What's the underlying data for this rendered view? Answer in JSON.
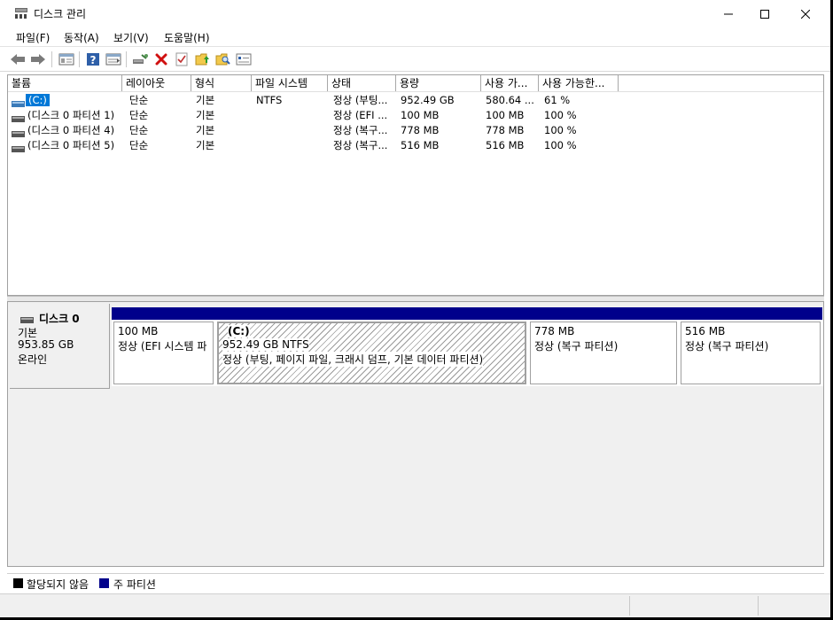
{
  "window": {
    "title": "디스크 관리",
    "icon": "disk-management-icon"
  },
  "menu": [
    {
      "label": "파일(F)"
    },
    {
      "label": "동작(A)"
    },
    {
      "label": "보기(V)"
    },
    {
      "label": "도움말(H)"
    }
  ],
  "toolbar": {
    "buttons": [
      "back-icon",
      "forward-icon",
      "show-hide-tree-icon",
      "help-icon",
      "properties-view-icon",
      "connect-drive-icon",
      "delete-icon",
      "check-icon",
      "folder-up-icon",
      "folder-search-icon",
      "settings-list-icon"
    ]
  },
  "columns": [
    "볼륨",
    "레이아웃",
    "형식",
    "파일 시스템",
    "상태",
    "용량",
    "사용 가...",
    "사용 가능한..."
  ],
  "volumes": [
    {
      "name": "(C:)",
      "layout": "단순",
      "type": "기본",
      "fs": "NTFS",
      "status": "정상 (부팅...",
      "capacity": "952.49 GB",
      "free": "580.64 ...",
      "free_pct": "61 %"
    },
    {
      "name": "(디스크 0 파티션 1)",
      "layout": "단순",
      "type": "기본",
      "fs": "",
      "status": "정상 (EFI ...",
      "capacity": "100 MB",
      "free": "100 MB",
      "free_pct": "100 %"
    },
    {
      "name": "(디스크 0 파티션 4)",
      "layout": "단순",
      "type": "기본",
      "fs": "",
      "status": "정상 (복구...",
      "capacity": "778 MB",
      "free": "778 MB",
      "free_pct": "100 %"
    },
    {
      "name": "(디스크 0 파티션 5)",
      "layout": "단순",
      "type": "기본",
      "fs": "",
      "status": "정상 (복구...",
      "capacity": "516 MB",
      "free": "516 MB",
      "free_pct": "100 %"
    }
  ],
  "disk": {
    "name": "디스크 0",
    "type": "기본",
    "size": "953.85 GB",
    "state": "온라인"
  },
  "partitions": [
    {
      "label": "",
      "size": "100 MB",
      "status": "정상 (EFI 시스템 파"
    },
    {
      "label": "(C:)",
      "size": "952.49 GB NTFS",
      "status": "정상 (부팅, 페이지 파일, 크래시 덤프, 기본 데이터 파티션)"
    },
    {
      "label": "",
      "size": "778 MB",
      "status": "정상 (복구 파티션)"
    },
    {
      "label": "",
      "size": "516 MB",
      "status": "정상 (복구 파티션)"
    }
  ],
  "legend": [
    {
      "label": "할당되지 않음",
      "color": "#000000"
    },
    {
      "label": "주 파티션",
      "color": "#00008b"
    }
  ],
  "colors": {
    "primary_partition": "#00008b",
    "selection": "#0078d7"
  }
}
